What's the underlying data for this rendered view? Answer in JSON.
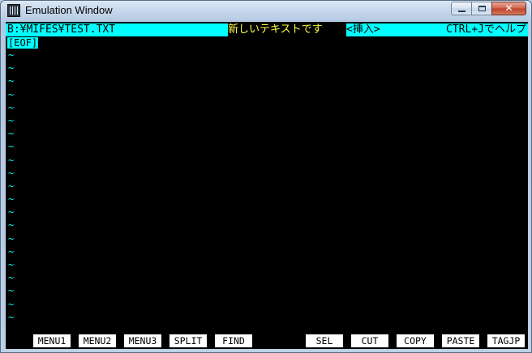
{
  "window": {
    "title": "Emulation Window",
    "icon": "terminal-app-icon",
    "controls": {
      "minimize": "minimize-icon",
      "maximize": "maximize-icon",
      "close_glyph": "✕"
    }
  },
  "status": {
    "file": "B:¥MIFES¥TEST.TXT",
    "message": "新しいテキストです",
    "mode": "<挿入>",
    "help": "CTRL+Jでヘルプ"
  },
  "editor": {
    "eof": "[EOF]",
    "tilde": "~"
  },
  "fkeys": [
    "MENU1",
    "MENU2",
    "MENU3",
    "SPLIT",
    "FIND",
    "",
    "SEL",
    "CUT",
    "COPY",
    "PASTE",
    "TAGJP"
  ],
  "colors": {
    "status_bg": "#00ffff",
    "message_fg": "#ffff4a",
    "screen_bg": "#000000",
    "fkey_bg": "#ffffff"
  }
}
